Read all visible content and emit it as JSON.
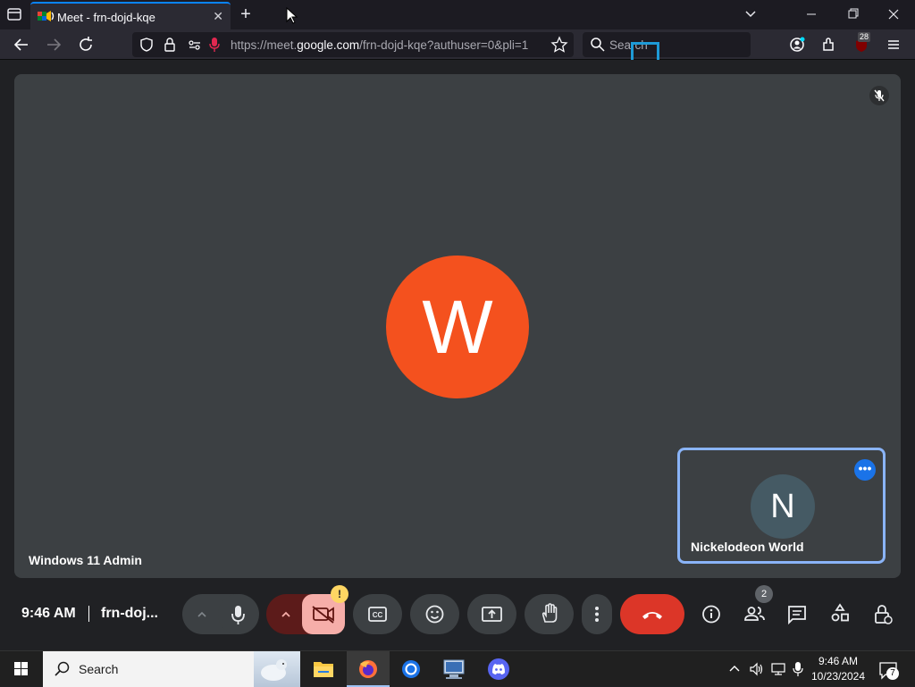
{
  "browser": {
    "tab_title": "Meet - frn-dojd-kqe",
    "url_prefix": "https://meet.",
    "url_domain": "google.com",
    "url_path": "/frn-dojd-kqe?authuser=0&pli=1",
    "search_placeholder": "Search",
    "notification_badge": "28"
  },
  "meet": {
    "main_participant_initial": "W",
    "main_participant_name": "Windows 11 Admin",
    "self_initial": "N",
    "self_name": "Nickelodeon World",
    "clock": "9:46 AM",
    "meeting_code": "frn-doj...",
    "people_count": "2",
    "camera_warning": "!"
  },
  "colors": {
    "main_avatar": "#f4511e",
    "self_avatar": "#455a64",
    "end_call": "#d93025",
    "accent": "#8ab4f8"
  },
  "taskbar": {
    "search_label": "Search",
    "time": "9:46 AM",
    "date": "10/23/2024",
    "notification_count": "7"
  }
}
